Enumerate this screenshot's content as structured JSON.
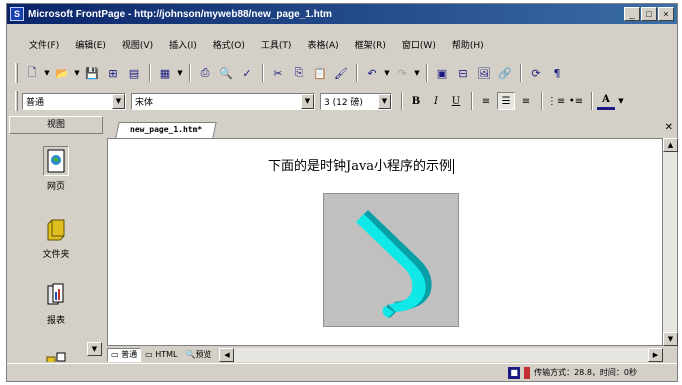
{
  "window": {
    "title": "Microsoft FrontPage - http://johnson/myweb88/new_page_1.htm",
    "app_icon_glyph": "S",
    "controls": [
      "_",
      "□",
      "×"
    ]
  },
  "menu": [
    "文件(F)",
    "编辑(E)",
    "视图(V)",
    "插入(I)",
    "格式(O)",
    "工具(T)",
    "表格(A)",
    "框架(R)",
    "窗口(W)",
    "帮助(H)"
  ],
  "toolbar_standard": {
    "icons": [
      "new-page-icon",
      "open-icon",
      "save-icon",
      "publish-icon",
      "folder-list-icon",
      "navigation-icon",
      "print-icon",
      "preview-icon",
      "spelling-icon",
      "cut-icon",
      "copy-icon",
      "paste-icon",
      "format-painter-icon",
      "undo-icon",
      "redo-icon",
      "insert-component-icon",
      "insert-table-icon",
      "insert-picture-icon",
      "hyperlink-icon",
      "refresh-icon",
      "show-all-icon"
    ]
  },
  "toolbar_format": {
    "style": "普通",
    "font": "宋体",
    "size": "3 (12 磅)",
    "bold": "B",
    "italic": "I",
    "underline": "U",
    "align_active": "center",
    "font_color_label": "A"
  },
  "views_bar": {
    "title": "视图",
    "items": [
      {
        "label": "网页",
        "icon": "page-view-icon",
        "selected": true
      },
      {
        "label": "文件夹",
        "icon": "folder-view-icon",
        "selected": false
      },
      {
        "label": "报表",
        "icon": "reports-view-icon",
        "selected": false
      }
    ]
  },
  "document": {
    "tab": "new_page_1.htm*",
    "text": "下面的是时钟Java小程序的示例",
    "applet": "java-clock-applet"
  },
  "bottom_tabs": [
    "普通",
    "HTML",
    "预览"
  ],
  "active_bottom_tab": "普通",
  "status": {
    "text": "传输方式：28.8，时间：0秒"
  },
  "colors": {
    "title_start": "#0a246a",
    "title_end": "#3a6ea5",
    "chrome": "#d4d0c8",
    "applet_bg": "#c0c0c0",
    "hook_face": "#10e8e8",
    "hook_shade": "#08a0a8"
  }
}
